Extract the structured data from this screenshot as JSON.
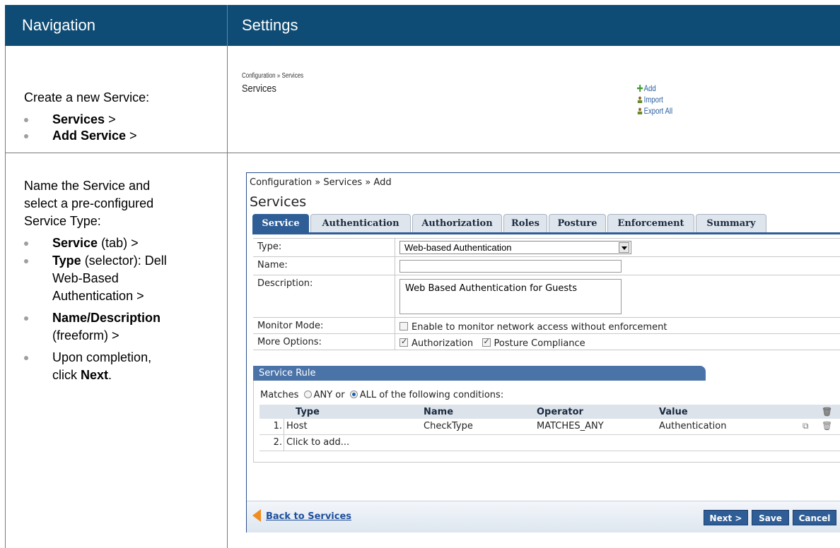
{
  "header": {
    "navigation": "Navigation",
    "settings": "Settings"
  },
  "row1": {
    "intro": "Create a new Service:",
    "bullets": [
      {
        "bold": "Services",
        "rest": " >"
      },
      {
        "bold": "Add Service",
        "rest": " >"
      }
    ],
    "breadcrumb": "Configuration » Services",
    "title": "Services",
    "actions": [
      {
        "label": "Add",
        "icon": "plus-icon",
        "color": "#3a9a2a"
      },
      {
        "label": "Import",
        "icon": "import-icon",
        "color": "#6a8a2a"
      },
      {
        "label": "Export All",
        "icon": "export-icon",
        "color": "#6a8a2a"
      }
    ]
  },
  "row2": {
    "intro_lines": [
      "Name the Service and",
      "select a pre-configured",
      "Service Type:"
    ],
    "b1_bold": "Service",
    "b1_rest": " (tab) >",
    "b2_bold": "Type",
    "b2_rest1": " (selector): Dell",
    "b2_rest2": "Web-Based",
    "b2_rest3": "Authentication >",
    "b3_bold": "Name/Description",
    "b3_rest": "(freeform) >",
    "b4_line1": "Upon completion,",
    "b4_pre": "click ",
    "b4_bold": "Next",
    "b4_post": "."
  },
  "app": {
    "breadcrumb": "Configuration » Services » Add",
    "title": "Services",
    "tabs": [
      "Service",
      "Authentication",
      "Authorization",
      "Roles",
      "Posture",
      "Enforcement",
      "Summary"
    ],
    "form": {
      "type_label": "Type:",
      "type_value": "Web-based Authentication",
      "name_label": "Name:",
      "name_value": "",
      "desc_label": "Description:",
      "desc_value": "Web Based Authentication for Guests",
      "monitor_label": "Monitor Mode:",
      "monitor_text": "Enable to monitor network access without enforcement",
      "options_label": "More Options:",
      "opt_authorization": "Authorization",
      "opt_posture": "Posture Compliance"
    },
    "rule": {
      "header": "Service Rule",
      "matches_pre": "Matches",
      "any": "ANY or",
      "all": "ALL of the following conditions:",
      "columns": [
        "Type",
        "Name",
        "Operator",
        "Value"
      ],
      "row1": {
        "num": "1.",
        "type": "Host",
        "name": "CheckType",
        "operator": "MATCHES_ANY",
        "value": "Authentication"
      },
      "row2": {
        "num": "2.",
        "text": "Click to add..."
      }
    },
    "footer": {
      "back": "Back to Services",
      "next": "Next >",
      "save": "Save",
      "cancel": "Cancel"
    }
  }
}
